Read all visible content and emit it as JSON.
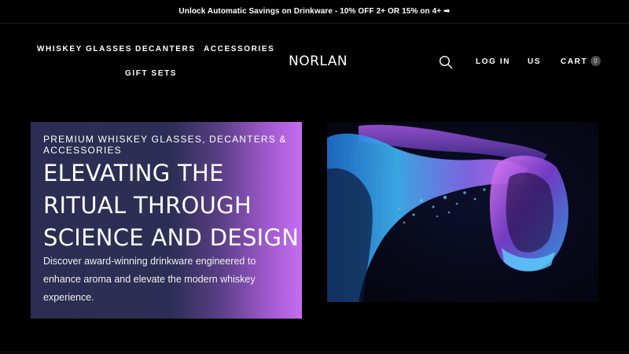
{
  "announcement": {
    "text": "Unlock Automatic Savings on Drinkware - 10% OFF 2+ OR 15% on 4+ ➡"
  },
  "nav": {
    "whiskey_glasses": "WHISKEY GLASSES",
    "decanters": "DECANTERS",
    "accessories": "ACCESSORIES",
    "gift_sets": "GIFT SETS"
  },
  "logo": "NORLAN",
  "header_actions": {
    "search_icon": "search-icon",
    "log_in": "LOG IN",
    "region": "US",
    "cart": "CART",
    "cart_count": "0"
  },
  "hero": {
    "eyebrow": "PREMIUM WHISKEY GLASSES, DECANTERS & ACCESSORIES",
    "title": "ELEVATING THE RITUAL THROUGH SCIENCE AND DESIGN",
    "description": "Discover award-winning drinkware engineered to enhance aroma and elevate the modern whiskey experience.",
    "image": "whiskey-glass-splash-image"
  },
  "colors": {
    "background": "#000000",
    "gradient_start": "#2b2d52",
    "gradient_end": "#c46ef0",
    "splash_blue": "#3fa8f0",
    "splash_purple": "#b14cf0"
  }
}
